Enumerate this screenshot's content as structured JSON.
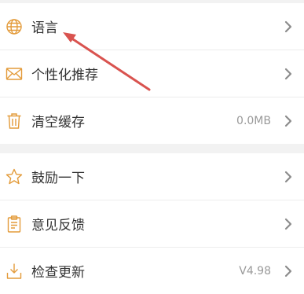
{
  "colors": {
    "icon_orange": "#e39b3a",
    "chevron": "#8c8c8c",
    "annotation_arrow": "#d9534f"
  },
  "settings": {
    "group1": [
      {
        "id": "language",
        "label": "语言",
        "value": "",
        "icon": "globe-icon"
      },
      {
        "id": "personalized",
        "label": "个性化推荐",
        "value": "",
        "icon": "envelope-icon"
      },
      {
        "id": "clear-cache",
        "label": "清空缓存",
        "value": "0.0MB",
        "icon": "trash-icon"
      }
    ],
    "group2": [
      {
        "id": "encourage",
        "label": "鼓励一下",
        "value": "",
        "icon": "star-icon"
      },
      {
        "id": "feedback",
        "label": "意见反馈",
        "value": "",
        "icon": "clipboard-icon"
      },
      {
        "id": "check-update",
        "label": "检查更新",
        "value": "V4.98",
        "icon": "download-icon"
      }
    ]
  }
}
